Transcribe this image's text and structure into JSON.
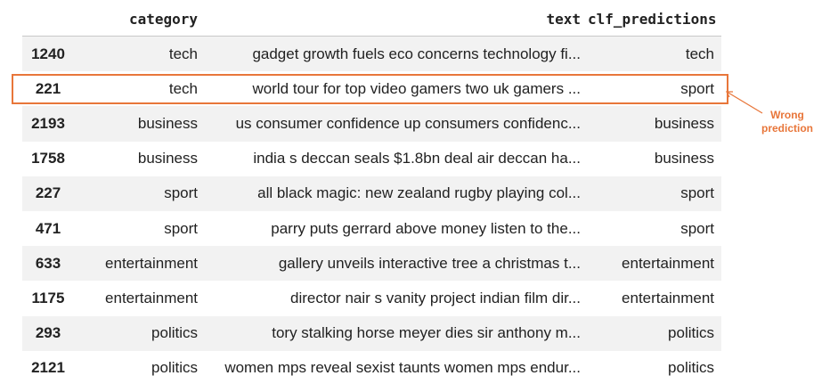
{
  "table": {
    "columns": [
      "",
      "category",
      "text",
      "clf_predictions"
    ],
    "rows": [
      {
        "index": "1240",
        "category": "tech",
        "text": "gadget growth fuels eco concerns technology fi...",
        "clf_predictions": "tech"
      },
      {
        "index": "221",
        "category": "tech",
        "text": "world tour for top video gamers two uk gamers ...",
        "clf_predictions": "sport"
      },
      {
        "index": "2193",
        "category": "business",
        "text": "us consumer confidence up consumers confidenc...",
        "clf_predictions": "business"
      },
      {
        "index": "1758",
        "category": "business",
        "text": "india s deccan seals $1.8bn deal air deccan ha...",
        "clf_predictions": "business"
      },
      {
        "index": "227",
        "category": "sport",
        "text": "all black magic: new zealand rugby playing col...",
        "clf_predictions": "sport"
      },
      {
        "index": "471",
        "category": "sport",
        "text": "parry puts gerrard above money listen to the...",
        "clf_predictions": "sport"
      },
      {
        "index": "633",
        "category": "entertainment",
        "text": "gallery unveils interactive tree a christmas t...",
        "clf_predictions": "entertainment"
      },
      {
        "index": "1175",
        "category": "entertainment",
        "text": "director nair s vanity project indian film dir...",
        "clf_predictions": "entertainment"
      },
      {
        "index": "293",
        "category": "politics",
        "text": "tory stalking horse meyer dies sir anthony m...",
        "clf_predictions": "politics"
      },
      {
        "index": "2121",
        "category": "politics",
        "text": "women mps reveal sexist taunts women mps endur...",
        "clf_predictions": "politics"
      }
    ]
  },
  "annotation": {
    "line1": "Wrong",
    "line2": "prediction",
    "color": "#e8763a"
  }
}
